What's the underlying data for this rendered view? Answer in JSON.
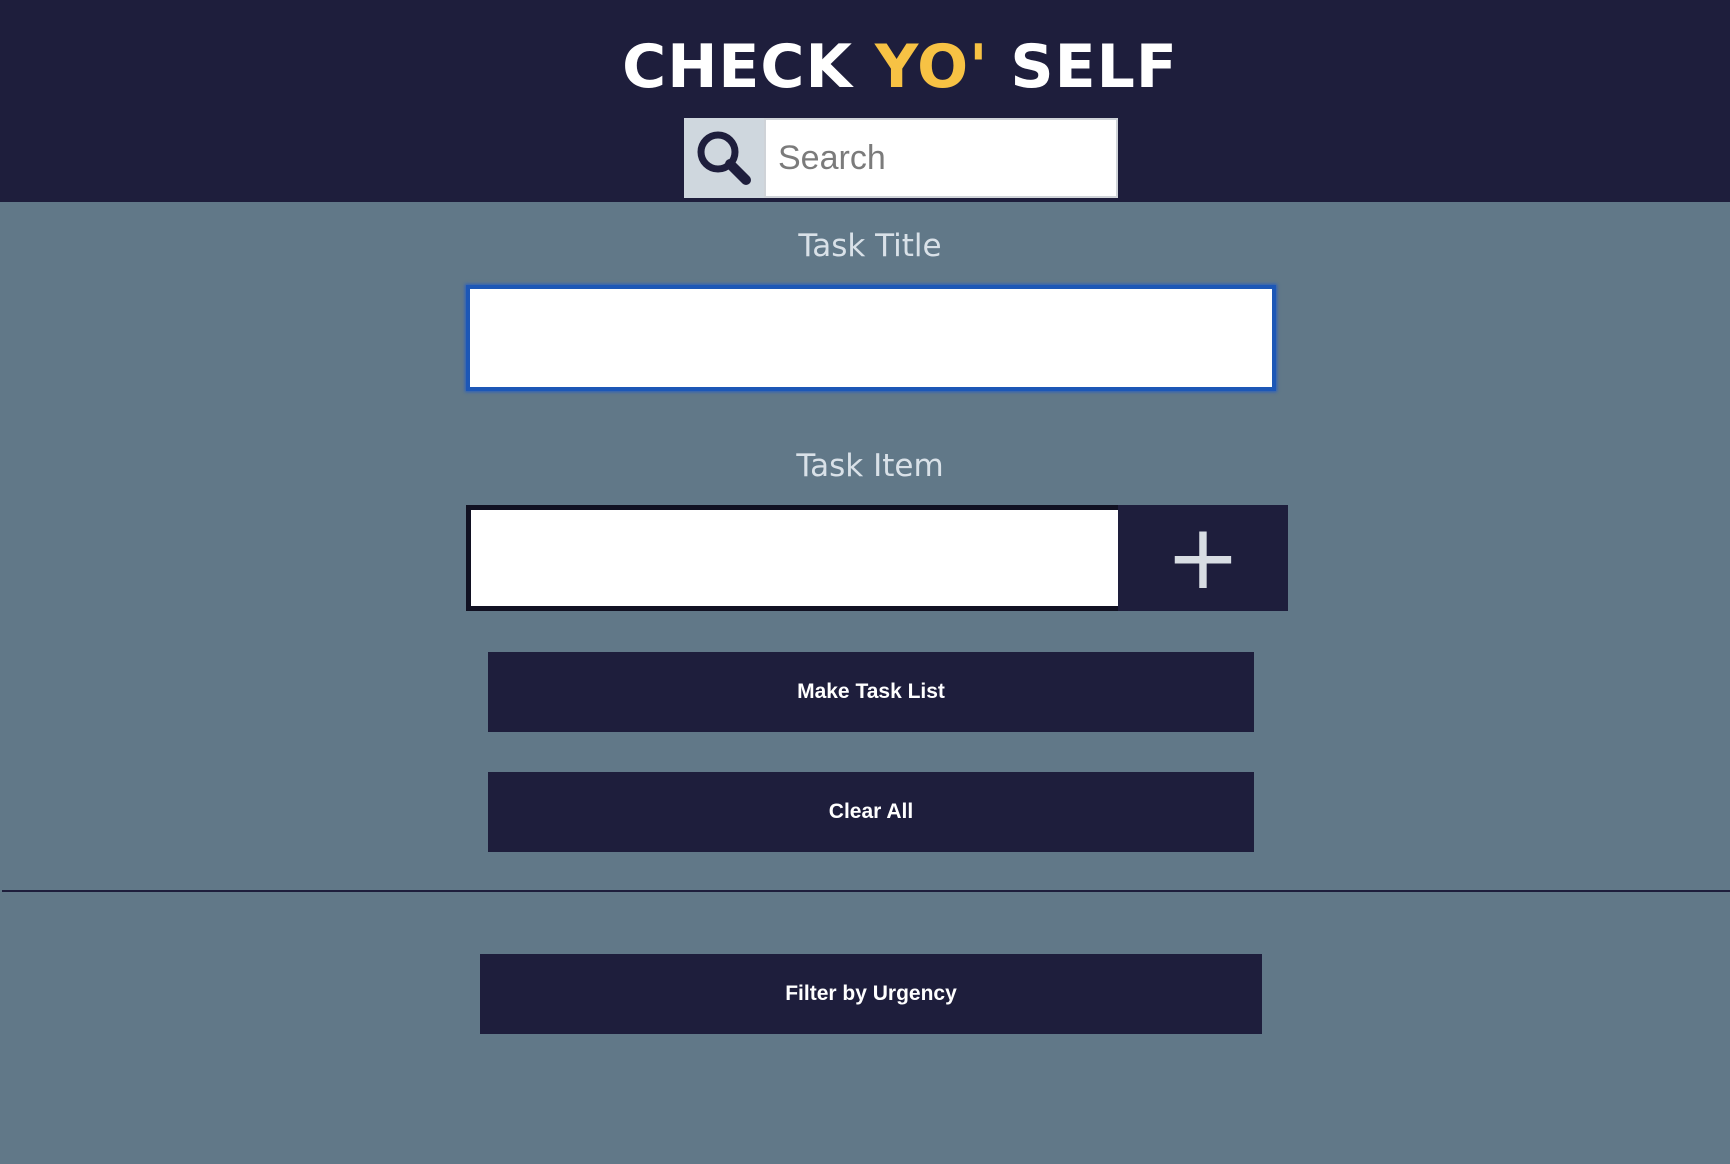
{
  "header": {
    "title_part1": "CHECK ",
    "title_accent": "YO'",
    "title_part2": " SELF",
    "search_placeholder": "Search",
    "search_value": ""
  },
  "form": {
    "task_title_label": "Task Title",
    "task_title_value": "",
    "task_item_label": "Task Item",
    "task_item_value": "",
    "add_item_symbol": "+",
    "make_task_list_label": "Make Task List",
    "clear_all_label": "Clear All"
  },
  "filter": {
    "filter_button_label": "Filter by Urgency"
  },
  "colors": {
    "header_bg": "#1e1e3c",
    "page_bg": "#617888",
    "accent": "#f7c244",
    "button_bg": "#1e1e3c"
  },
  "icons": {
    "search": "search-icon",
    "add": "plus-icon"
  }
}
